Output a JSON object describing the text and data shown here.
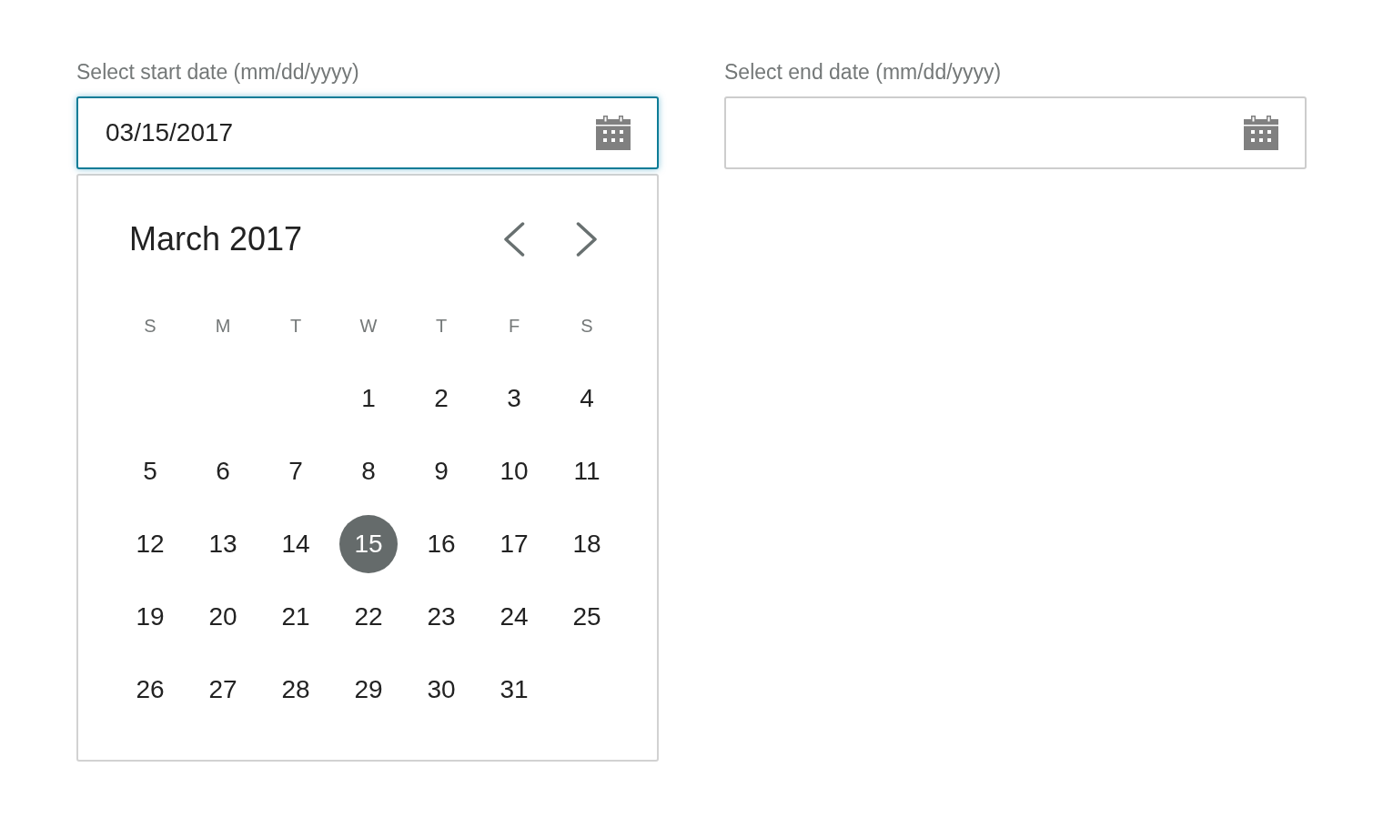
{
  "date_fields": [
    {
      "label": "Select start date (mm/dd/yyyy)",
      "value": "03/15/2017",
      "focused": true,
      "calendar": {
        "open": true,
        "title": "March 2017",
        "weekdays": [
          "S",
          "M",
          "T",
          "W",
          "T",
          "F",
          "S"
        ],
        "weeks": [
          [
            {
              "label": "1",
              "selected": false
            },
            {
              "label": "2",
              "selected": false
            },
            {
              "label": "3",
              "selected": false
            },
            {
              "label": "4",
              "selected": false
            }
          ],
          [
            {
              "label": "5",
              "selected": false
            },
            {
              "label": "6",
              "selected": false
            },
            {
              "label": "7",
              "selected": false
            },
            {
              "label": "8",
              "selected": false
            },
            {
              "label": "9",
              "selected": false
            },
            {
              "label": "10",
              "selected": false
            },
            {
              "label": "11",
              "selected": false
            }
          ],
          [
            {
              "label": "12",
              "selected": false
            },
            {
              "label": "13",
              "selected": false
            },
            {
              "label": "14",
              "selected": false
            },
            {
              "label": "15",
              "selected": true
            },
            {
              "label": "16",
              "selected": false
            },
            {
              "label": "17",
              "selected": false
            },
            {
              "label": "18",
              "selected": false
            }
          ],
          [
            {
              "label": "19",
              "selected": false
            },
            {
              "label": "20",
              "selected": false
            },
            {
              "label": "21",
              "selected": false
            },
            {
              "label": "22",
              "selected": false
            },
            {
              "label": "23",
              "selected": false
            },
            {
              "label": "24",
              "selected": false
            },
            {
              "label": "25",
              "selected": false
            }
          ],
          [
            {
              "label": "26",
              "selected": false
            },
            {
              "label": "27",
              "selected": false
            },
            {
              "label": "28",
              "selected": false
            },
            {
              "label": "29",
              "selected": false
            },
            {
              "label": "30",
              "selected": false
            },
            {
              "label": "31",
              "selected": false
            }
          ]
        ]
      }
    },
    {
      "label": "Select end date (mm/dd/yyyy)",
      "focused": false
    }
  ]
}
